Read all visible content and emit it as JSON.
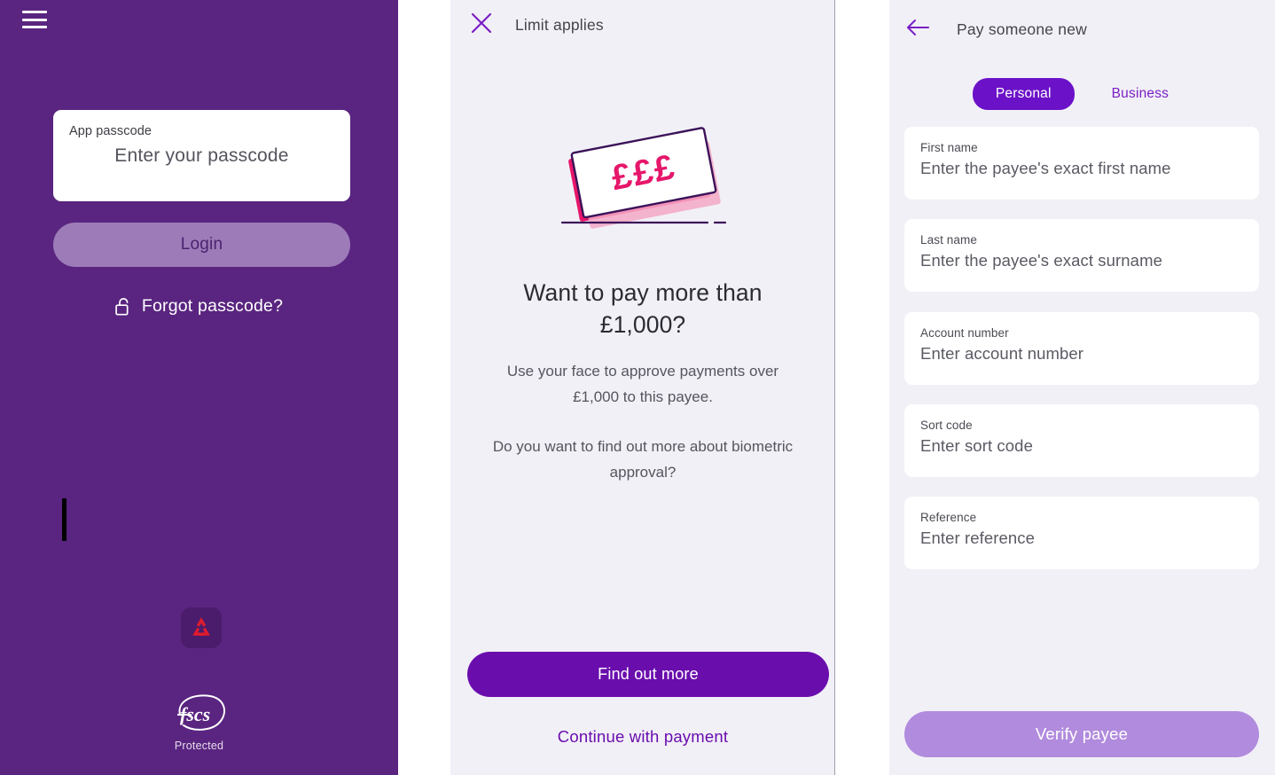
{
  "colors": {
    "brand_purple": "#5A2580",
    "accent_purple": "#6A0DAD",
    "tab_purple": "#6B12C8",
    "panel_bg": "#F1F0F7",
    "disabled_button": "#B18BDD",
    "login_button": "#9D7BB8",
    "money_pink": "#E6176B",
    "outline_purple": "#3B1258"
  },
  "login_screen": {
    "menu_icon": "hamburger-icon",
    "passcode_field": {
      "label": "App passcode",
      "placeholder": "Enter your passcode",
      "value": ""
    },
    "login_button_label": "Login",
    "forgot_link": {
      "icon": "lock-open-icon",
      "label": "Forgot passcode?"
    },
    "brand_logo_name": "natwest-logo",
    "fscs": {
      "logo_text": "fscs",
      "caption": "Protected"
    }
  },
  "limit_screen": {
    "close_icon": "close-icon",
    "title": "Limit applies",
    "illustration_name": "banknotes-illustration",
    "illustration_symbols": "£££",
    "heading": "Want to pay more than £1,000?",
    "body_1": "Use your face to approve payments over £1,000 to this payee.",
    "body_2": "Do you want to find out more about biometric approval?",
    "primary_button_label": "Find out more",
    "secondary_link_label": "Continue with payment"
  },
  "pay_screen": {
    "back_icon": "back-arrow-icon",
    "title": "Pay someone new",
    "tabs": [
      {
        "label": "Personal",
        "active": true
      },
      {
        "label": "Business",
        "active": false
      }
    ],
    "fields": [
      {
        "label": "First name",
        "placeholder": "Enter the payee's exact first name",
        "value": ""
      },
      {
        "label": "Last name",
        "placeholder": "Enter the payee's exact surname",
        "value": ""
      },
      {
        "label": "Account number",
        "placeholder": "Enter account number",
        "value": ""
      },
      {
        "label": "Sort code",
        "placeholder": "Enter sort code",
        "value": ""
      },
      {
        "label": "Reference",
        "placeholder": "Enter reference",
        "value": ""
      }
    ],
    "submit_button_label": "Verify payee"
  }
}
